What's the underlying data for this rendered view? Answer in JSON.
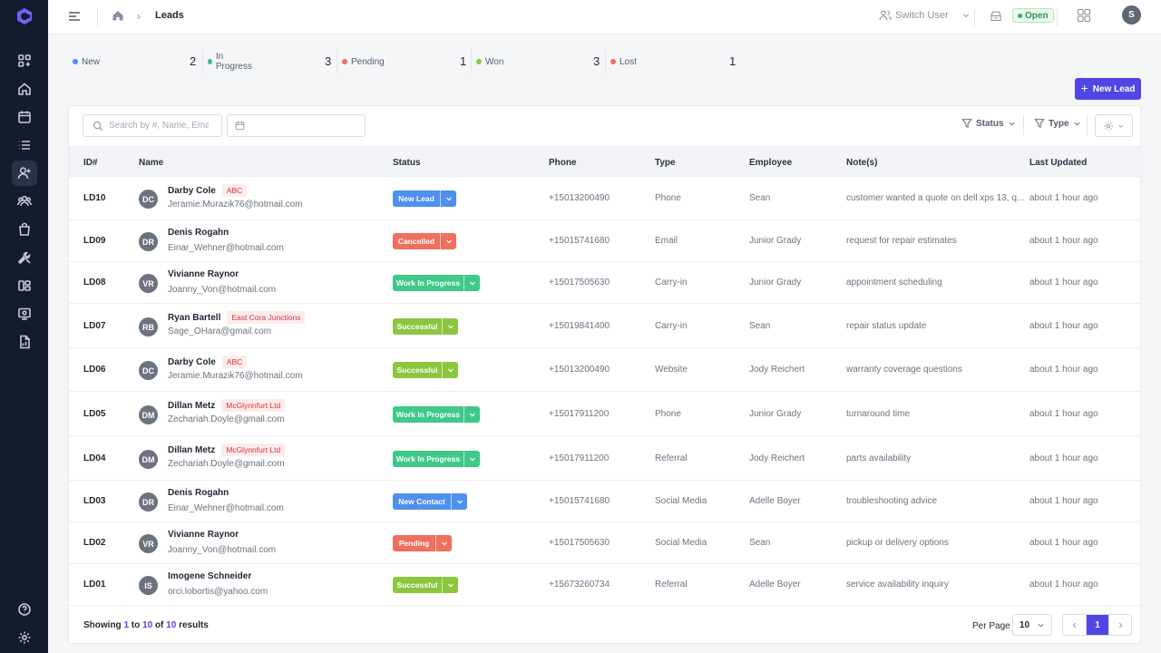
{
  "header": {
    "breadcrumb_title": "Leads",
    "switch_user_label": "Switch User",
    "open_status_label": "Open",
    "user_initial": "S"
  },
  "stats": [
    {
      "label": "New",
      "count": "2",
      "color": "#4f8ff0"
    },
    {
      "label": "In Progress",
      "count": "3",
      "color": "#2fbf85"
    },
    {
      "label": "Pending",
      "count": "1",
      "color": "#f0705e"
    },
    {
      "label": "Won",
      "count": "3",
      "color": "#8cc63f"
    },
    {
      "label": "Lost",
      "count": "1",
      "color": "#f0705e"
    }
  ],
  "toolbar": {
    "new_lead_label": "New Lead",
    "search_placeholder": "Search by #, Name, Email, Com",
    "status_filter_label": "Status",
    "type_filter_label": "Type"
  },
  "table": {
    "columns": [
      "ID#",
      "Name",
      "Status",
      "Phone",
      "Type",
      "Employee",
      "Note(s)",
      "Last Updated"
    ],
    "rows": [
      {
        "id": "LD10",
        "initials": "DC",
        "name": "Darby Cole",
        "company": "ABC",
        "email": "Jeramie.Murazik76@hotmail.com",
        "status": "New Lead",
        "status_color": "#4f8ff0",
        "phone": "+15013200490",
        "type": "Phone",
        "employee": "Sean",
        "note": "customer wanted a quote on dell xps 13, q...",
        "updated": "about 1 hour ago"
      },
      {
        "id": "LD09",
        "initials": "DR",
        "name": "Denis Rogahn",
        "company": "",
        "email": "Einar_Wehner@hotmail.com",
        "status": "Cancelled",
        "status_color": "#f0705e",
        "phone": "+15015741680",
        "type": "Email",
        "employee": "Junior Grady",
        "note": "request for repair estimates",
        "updated": "about 1 hour ago"
      },
      {
        "id": "LD08",
        "initials": "VR",
        "name": "Vivianne Raynor",
        "company": "",
        "email": "Joanny_Von@hotmail.com",
        "status": "Work In Progress",
        "status_color": "#3ec989",
        "phone": "+15017505630",
        "type": "Carry-in",
        "employee": "Junior Grady",
        "note": "appointment scheduling",
        "updated": "about 1 hour ago"
      },
      {
        "id": "LD07",
        "initials": "RB",
        "name": "Ryan Bartell",
        "company": "East Cora Junctions",
        "email": "Sage_OHara@gmail.com",
        "status": "Successful",
        "status_color": "#8cc63f",
        "phone": "+15019841400",
        "type": "Carry-in",
        "employee": "Sean",
        "note": "repair status update",
        "updated": "about 1 hour ago"
      },
      {
        "id": "LD06",
        "initials": "DC",
        "name": "Darby Cole",
        "company": "ABC",
        "email": "Jeramie.Murazik76@hotmail.com",
        "status": "Successful",
        "status_color": "#8cc63f",
        "phone": "+15013200490",
        "type": "Website",
        "employee": "Jody Reichert",
        "note": "warranty coverage questions",
        "updated": "about 1 hour ago"
      },
      {
        "id": "LD05",
        "initials": "DM",
        "name": "Dillan Metz",
        "company": "McGlynnfurt Ltd",
        "email": "Zechariah.Doyle@gmail.com",
        "status": "Work In Progress",
        "status_color": "#3ec989",
        "phone": "+15017911200",
        "type": "Phone",
        "employee": "Junior Grady",
        "note": "turnaround time",
        "updated": "about 1 hour ago"
      },
      {
        "id": "LD04",
        "initials": "DM",
        "name": "Dillan Metz",
        "company": "McGlynnfurt Ltd",
        "email": "Zechariah.Doyle@gmail.com",
        "status": "Work In Progress",
        "status_color": "#3ec989",
        "phone": "+15017911200",
        "type": "Referral",
        "employee": "Jody Reichert",
        "note": "parts availability",
        "updated": "about 1 hour ago"
      },
      {
        "id": "LD03",
        "initials": "DR",
        "name": "Denis Rogahn",
        "company": "",
        "email": "Einar_Wehner@hotmail.com",
        "status": "New Contact",
        "status_color": "#4f8ff0",
        "phone": "+15015741680",
        "type": "Social Media",
        "employee": "Adelle Boyer",
        "note": "troubleshooting advice",
        "updated": "about 1 hour ago"
      },
      {
        "id": "LD02",
        "initials": "VR",
        "name": "Vivianne Raynor",
        "company": "",
        "email": "Joanny_Von@hotmail.com",
        "status": "Pending",
        "status_color": "#f0705e",
        "phone": "+15017505630",
        "type": "Social Media",
        "employee": "Sean",
        "note": "pickup or delivery options",
        "updated": "about 1 hour ago"
      },
      {
        "id": "LD01",
        "initials": "IS",
        "name": "Imogene Schneider",
        "company": "",
        "email": "orci.lobortis@yahoo.com",
        "status": "Successful",
        "status_color": "#8cc63f",
        "phone": "+15673260734",
        "type": "Referral",
        "employee": "Adelle Boyer",
        "note": "service availability inquiry",
        "updated": "about 1 hour ago"
      }
    ]
  },
  "footer": {
    "showing_prefix": "Showing",
    "range_start": "1",
    "to_word": "to",
    "range_end": "10",
    "of_word": "of",
    "total": "10",
    "results_word": "results",
    "per_page_label": "Per Page",
    "per_page_value": "10",
    "current_page": "1"
  },
  "colors": {
    "accent": "#4f46e5",
    "sidebar_bg": "#141b2d"
  }
}
